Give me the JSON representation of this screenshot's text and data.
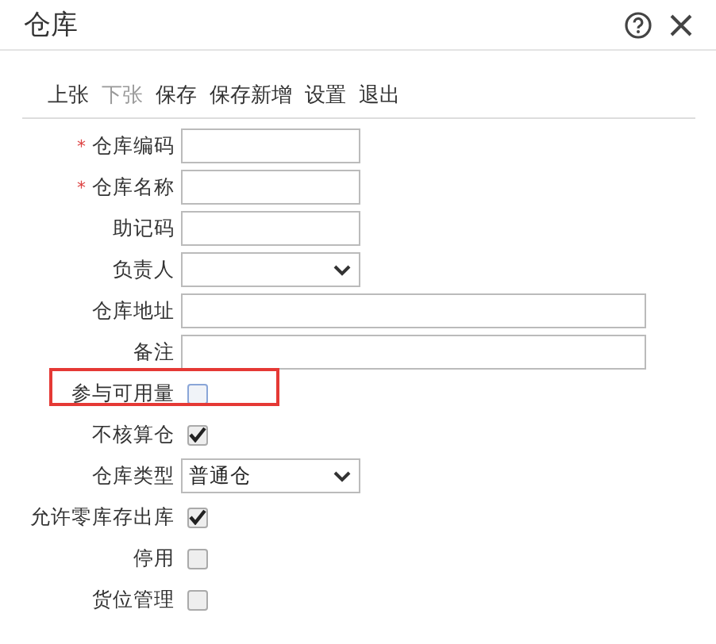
{
  "window": {
    "title": "仓库"
  },
  "toolbar": [
    {
      "label": "上张",
      "disabled": false
    },
    {
      "label": "下张",
      "disabled": true
    },
    {
      "label": "保存",
      "disabled": false
    },
    {
      "label": "保存新增",
      "disabled": false
    },
    {
      "label": "设置",
      "disabled": false
    },
    {
      "label": "退出",
      "disabled": false
    }
  ],
  "fields": [
    {
      "kind": "text",
      "label": "仓库编码",
      "required_mark": "*"
    },
    {
      "kind": "text",
      "label": "仓库名称",
      "required_mark": "*"
    },
    {
      "kind": "text",
      "label": "助记码"
    },
    {
      "kind": "select",
      "label": "负责人"
    },
    {
      "kind": "wide",
      "label": "仓库地址"
    },
    {
      "kind": "wide",
      "label": "备注"
    },
    {
      "kind": "checkbox",
      "label": "参与可用量",
      "checked": false,
      "highlighted": true
    },
    {
      "kind": "checkbox",
      "label": "不核算仓",
      "checked": true,
      "highlighted": false
    },
    {
      "kind": "select",
      "label": "仓库类型",
      "value": "普通仓"
    },
    {
      "kind": "checkbox",
      "label": "允许零库存出库",
      "checked": true,
      "highlighted": false
    },
    {
      "kind": "checkbox",
      "label": "停用",
      "checked": false,
      "highlighted": false
    },
    {
      "kind": "checkbox",
      "label": "货位管理",
      "checked": false,
      "highlighted": false
    }
  ]
}
